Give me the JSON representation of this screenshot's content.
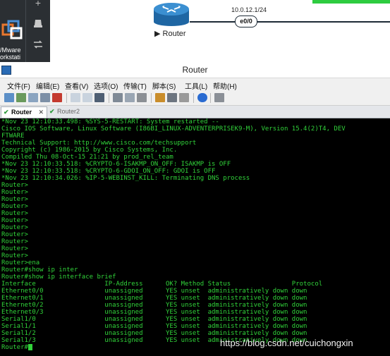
{
  "topology": {
    "vm_caption": "/Mware\norkstati",
    "node_label": "Router",
    "ip_label": "10.0.12.1/24",
    "interface_label": "e0/0"
  },
  "window": {
    "title": "Router"
  },
  "menu": [
    "文件(F)",
    "编辑(E)",
    "查看(V)",
    "选项(O)",
    "传输(T)",
    "脚本(S)",
    "工具(L)",
    "帮助(H)"
  ],
  "tabs": [
    {
      "label": "Router",
      "active": true
    },
    {
      "label": "Router2",
      "active": false
    }
  ],
  "terminal": {
    "lines": [
      "*Nov 23 12:10:33.498: %SYS-5-RESTART: System restarted --",
      "Cisco IOS Software, Linux Software (I86BI_LINUX-ADVENTERPRISEK9-M), Version 15.4(2)T4, DEV",
      "FTWARE",
      "Technical Support: http://www.cisco.com/techsupport",
      "Copyright (c) 1986-2015 by Cisco Systems, Inc.",
      "Compiled Thu 08-Oct-15 21:21 by prod_rel_team",
      "*Nov 23 12:10:33.518: %CRYPTO-6-ISAKMP_ON_OFF: ISAKMP is OFF",
      "*Nov 23 12:10:33.518: %CRYPTO-6-GDOI_ON_OFF: GDOI is OFF",
      "*Nov 23 12:10:34.026: %IP-5-WEBINST_KILL: Terminating DNS process",
      "Router>",
      "Router>",
      "Router>",
      "Router>",
      "Router>",
      "Router>",
      "Router>",
      "Router>",
      "Router>",
      "Router>",
      "Router>",
      "Router>ena",
      "Router#show ip inter",
      "Router#show ip interface brief",
      "Interface                  IP-Address      OK? Method Status                Protocol",
      "Ethernet0/0                unassigned      YES unset  administratively down down",
      "Ethernet0/1                unassigned      YES unset  administratively down down",
      "Ethernet0/2                unassigned      YES unset  administratively down down",
      "Ethernet0/3                unassigned      YES unset  administratively down down",
      "Serial1/0                  unassigned      YES unset  administratively down down",
      "Serial1/1                  unassigned      YES unset  administratively down down",
      "Serial1/2                  unassigned      YES unset  administratively down down",
      "Serial1/3                  unassigned      YES unset  administratively down down"
    ],
    "prompt": "Router#"
  },
  "watermark": "https://blog.csdn.net/cuichongxin",
  "colors": {
    "terminal_fg": "#31d33a",
    "terminal_bg": "#000000",
    "router_icon": "#2a7ab8"
  }
}
